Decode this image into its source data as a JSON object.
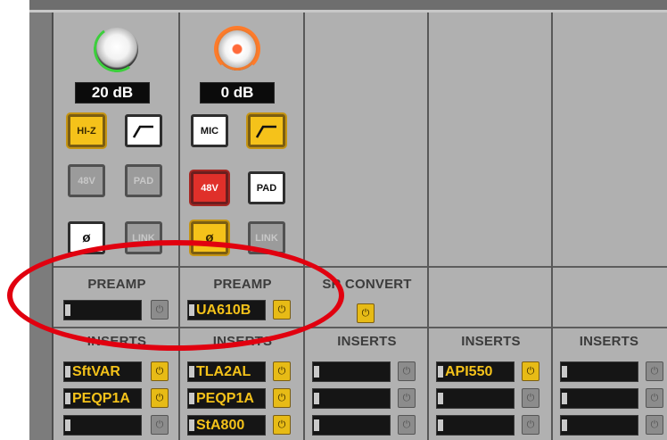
{
  "channels": [
    {
      "gain": "20 dB",
      "knob_style": "gray",
      "buttons": [
        {
          "label": "HI-Z",
          "style": "yellow"
        },
        {
          "label": "",
          "style": "white",
          "icon": "filter-icon"
        },
        {
          "label": "48V",
          "style": "gray"
        },
        {
          "label": "PAD",
          "style": "gray"
        },
        {
          "label": "ø",
          "style": "white"
        },
        {
          "label": "LINK",
          "style": "gray"
        }
      ],
      "section_label": "PREAMP",
      "slot": {
        "value": "",
        "power": "off"
      },
      "inserts_label": "INSERTS",
      "inserts": [
        {
          "value": "SftVAR",
          "power": "on"
        },
        {
          "value": "PEQP1A",
          "power": "on"
        },
        {
          "value": "",
          "power": "off"
        }
      ]
    },
    {
      "gain": "0 dB",
      "knob_style": "orange",
      "buttons": [
        {
          "label": "MIC",
          "style": "white"
        },
        {
          "label": "",
          "style": "yellow",
          "icon": "filter-icon"
        },
        {
          "label": "48V",
          "style": "red"
        },
        {
          "label": "PAD",
          "style": "white"
        },
        {
          "label": "ø",
          "style": "yellow"
        },
        {
          "label": "LINK",
          "style": "gray"
        }
      ],
      "section_label": "PREAMP",
      "slot": {
        "value": "UA610B",
        "power": "on"
      },
      "inserts_label": "INSERTS",
      "inserts": [
        {
          "value": "TLA2AL",
          "power": "on"
        },
        {
          "value": "PEQP1A",
          "power": "on"
        },
        {
          "value": "StA800",
          "power": "on"
        }
      ]
    },
    {
      "section_label": "SR CONVERT",
      "convert_power": "on",
      "inserts_label": "INSERTS",
      "inserts": [
        {
          "value": "",
          "power": "off"
        },
        {
          "value": "",
          "power": "off"
        },
        {
          "value": "",
          "power": "off"
        }
      ]
    },
    {
      "inserts_label": "INSERTS",
      "inserts": [
        {
          "value": "API550",
          "power": "on"
        },
        {
          "value": "",
          "power": "off"
        },
        {
          "value": "",
          "power": "off"
        }
      ]
    },
    {
      "inserts_label": "INSERTS",
      "inserts": [
        {
          "value": "",
          "power": "off"
        },
        {
          "value": "",
          "power": "off"
        },
        {
          "value": "",
          "power": "off"
        }
      ]
    }
  ],
  "colors": {
    "accent_yellow": "#f5c21a",
    "active_red": "#e0302a",
    "highlight_ellipse": "#e1000f",
    "panel": "#b1b1b1"
  }
}
